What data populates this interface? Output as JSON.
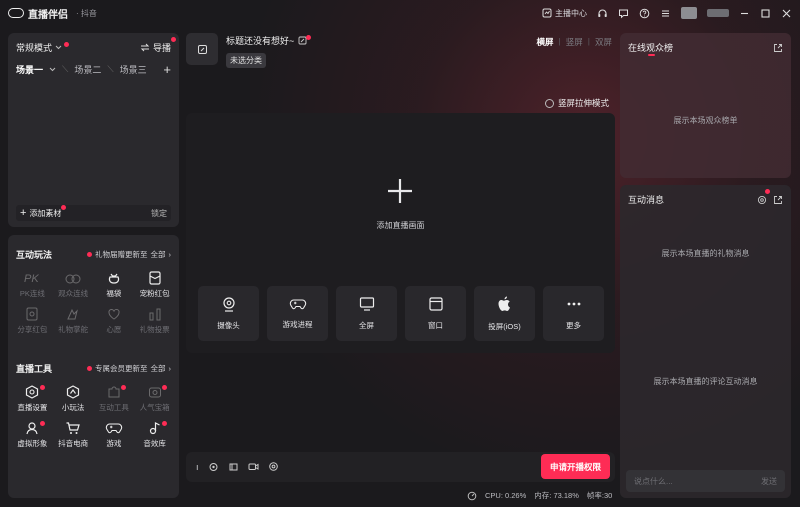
{
  "app": {
    "name": "直播伴侣",
    "sub": "· 抖音",
    "anchor_center": "主播中心"
  },
  "scene": {
    "mode_label": "常规模式",
    "guide_label": "导播",
    "tabs": [
      "场景一",
      "场景二",
      "场景三"
    ],
    "add_material": "添加素材",
    "lock": "锁定"
  },
  "interactive": {
    "title": "互动玩法",
    "note": "礼物届赠更新至",
    "all": "全部",
    "items": [
      {
        "label": "PK连线",
        "dim": true
      },
      {
        "label": "观众连线",
        "dim": true
      },
      {
        "label": "福袋",
        "dim": false
      },
      {
        "label": "宠粉红包",
        "dim": false
      },
      {
        "label": "分享红包",
        "dim": true
      },
      {
        "label": "礼物掌舵",
        "dim": true
      },
      {
        "label": "心愿",
        "dim": true
      },
      {
        "label": "礼物投票",
        "dim": true
      }
    ]
  },
  "live_tools": {
    "title": "直播工具",
    "note": "专属会员更新至",
    "all": "全部",
    "items": [
      {
        "label": "直播设置",
        "dim": false
      },
      {
        "label": "小玩法",
        "dim": false
      },
      {
        "label": "互动工具",
        "dim": true
      },
      {
        "label": "人气宝箱",
        "dim": true
      },
      {
        "label": "虚拟形象",
        "dim": false
      },
      {
        "label": "抖音电商",
        "dim": false
      },
      {
        "label": "游戏",
        "dim": false
      },
      {
        "label": "音效库",
        "dim": false
      }
    ]
  },
  "stream": {
    "title_placeholder": "标题还没有想好~",
    "category": "未选分类",
    "orient": [
      "横屏",
      "竖屏",
      "双屏"
    ],
    "stretch": "竖屏拉伸模式",
    "add_label": "添加直播画面",
    "sources": [
      "摄像头",
      "游戏进程",
      "全屏",
      "窗口",
      "投屏(iOS)",
      "更多"
    ],
    "apply_button": "申请开播权限"
  },
  "status": {
    "cpu": "CPU: 0.26%",
    "mem": "内存: 73.18%",
    "fps": "帧率:30"
  },
  "viewers": {
    "title": "在线观众榜",
    "empty": "展示本场观众榜单"
  },
  "chat": {
    "title": "互动消息",
    "gift_empty": "展示本场直播的礼物消息",
    "comment_empty": "展示本场直播的评论互动消息",
    "input_placeholder": "说点什么...",
    "send": "发送"
  },
  "colors": {
    "accent": "#fe2c55",
    "panel": "#2a292d",
    "background": "#1b1a1d"
  }
}
